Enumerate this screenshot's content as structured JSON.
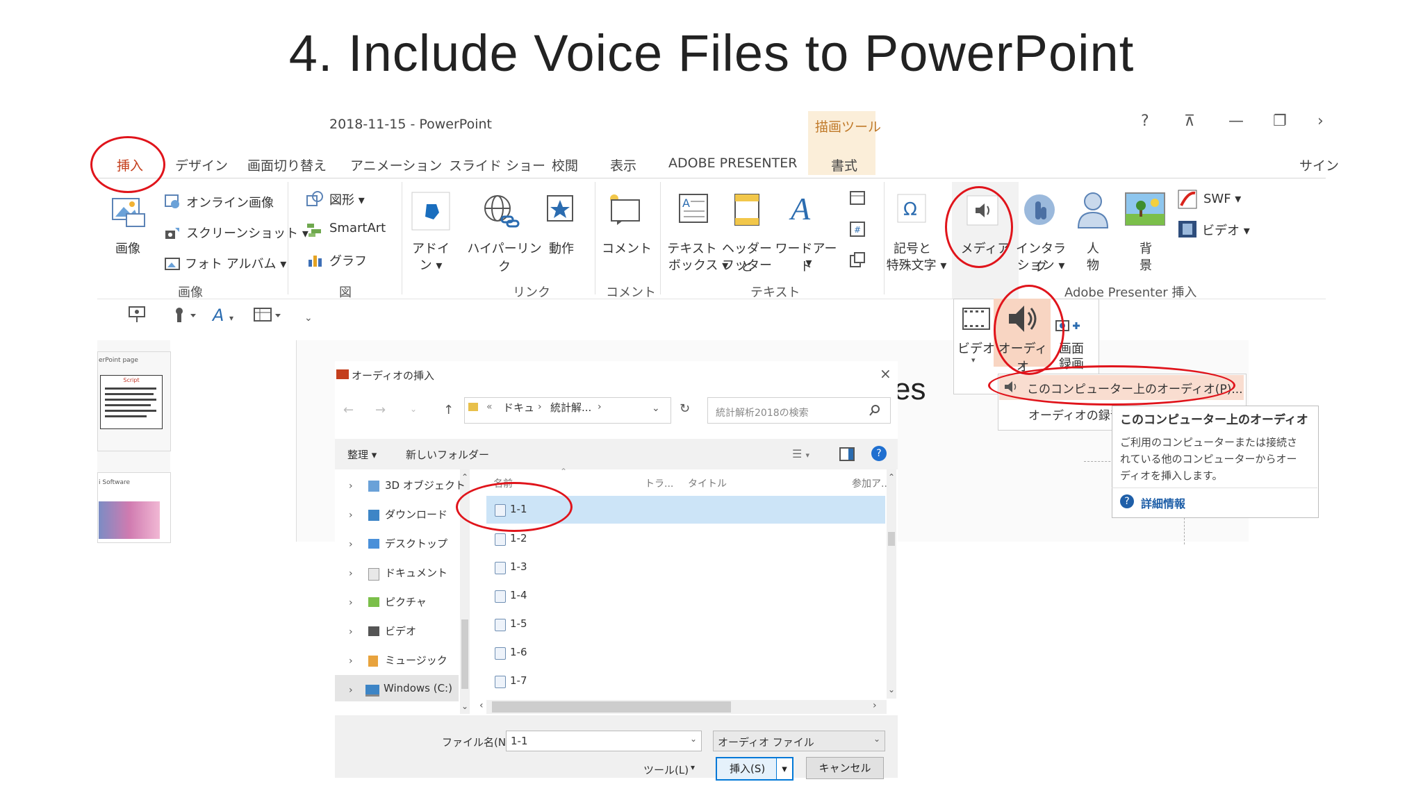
{
  "slide": {
    "title": "4. Include  Voice Files to PowerPoint"
  },
  "window": {
    "title": "2018-11-15 - PowerPoint",
    "context_tab": "描画ツール",
    "controls": {
      "help": "?",
      "restore_ribbon": "⊼",
      "minimize": "—",
      "restore": "❐",
      "more": "›"
    },
    "signin": "サイン"
  },
  "tabs": [
    "挿入",
    "デザイン",
    "画面切り替え",
    "アニメーション",
    "スライド ショー",
    "校閲",
    "表示",
    "ADOBE PRESENTER",
    "書式"
  ],
  "ribbon": {
    "images": {
      "label": "画像",
      "big": "画像",
      "online": "オンライン画像",
      "screenshot": "スクリーンショット ▾",
      "album": "フォト アルバム ▾"
    },
    "figures": {
      "label": "図",
      "shapes": "図形 ▾",
      "smartart": "SmartArt",
      "graph": "グラフ"
    },
    "links": {
      "label": "リンク",
      "addin_1": "アドイ",
      "addin_2": "ン ▾",
      "hyperlink": "ハイパーリンク",
      "action": "動作"
    },
    "comments": {
      "label": "コメント",
      "comment": "コメント"
    },
    "text": {
      "label": "テキスト",
      "textbox_1": "テキスト",
      "textbox_2": "ボックス ▾",
      "header_1": "ヘッダーと",
      "header_2": "フッター",
      "wordart": "ワードアート",
      "wordart_arrow": "▾"
    },
    "symbols": {
      "symbol_1": "記号と",
      "symbol_2": "特殊文字 ▾"
    },
    "media": {
      "media": "メディア"
    },
    "adobe": {
      "label": "Adobe Presenter 挿入",
      "interact_1": "インタラク",
      "interact_2": "ション ▾",
      "person_1": "人",
      "person_2": "物",
      "bg_1": "背",
      "bg_2": "景",
      "swf": "SWF ▾",
      "video": "ビデオ ▾"
    }
  },
  "media_dropdown": {
    "video": "ビデオ",
    "audio": "オーディオ",
    "screen_1": "画面",
    "screen_2": "録画",
    "menu_item_pc": "このコンピューター上のオーディオ(P)...",
    "menu_item_record": "オーディオの録音"
  },
  "tooltip": {
    "title": "このコンピューター上のオーディオ",
    "body_1": "ご利用のコンピューターまたは接続さ",
    "body_2": "れている他のコンピューターからオー",
    "body_3": "ディオを挿入します。",
    "more": "詳細情報"
  },
  "slide_fragment": "es",
  "thumbs": {
    "t1_caption": "erPoint page",
    "t1_title": "Script",
    "t2_caption": "i Software"
  },
  "dialog": {
    "title": "オーディオの挿入",
    "close": "×",
    "breadcrumb": [
      "«",
      "ドキュ",
      "›",
      "統計解...",
      "›"
    ],
    "search_placeholder": "統計解析2018の検索",
    "toolbar": {
      "organize": "整理 ▾",
      "new_folder": "新しいフォルダー"
    },
    "nav": [
      "3D オブジェクト",
      "ダウンロード",
      "デスクトップ",
      "ドキュメント",
      "ピクチャ",
      "ビデオ",
      "ミュージック",
      "Windows (C:)"
    ],
    "columns": {
      "name": "名前",
      "track": "トラ...",
      "title": "タイトル",
      "contrib": "参加ア..."
    },
    "files": [
      "1-1",
      "1-2",
      "1-3",
      "1-4",
      "1-5",
      "1-6",
      "1-7"
    ],
    "filename_label": "ファイル名(N):",
    "filename_value": "1-1",
    "filetype": "オーディオ ファイル",
    "tools": "ツール(L)",
    "insert": "挿入(S)",
    "cancel": "キャンセル"
  },
  "colors": {
    "highlight_red": "#e0141b",
    "accent_blue": "#0078d7",
    "selection": "#cce4f7"
  }
}
